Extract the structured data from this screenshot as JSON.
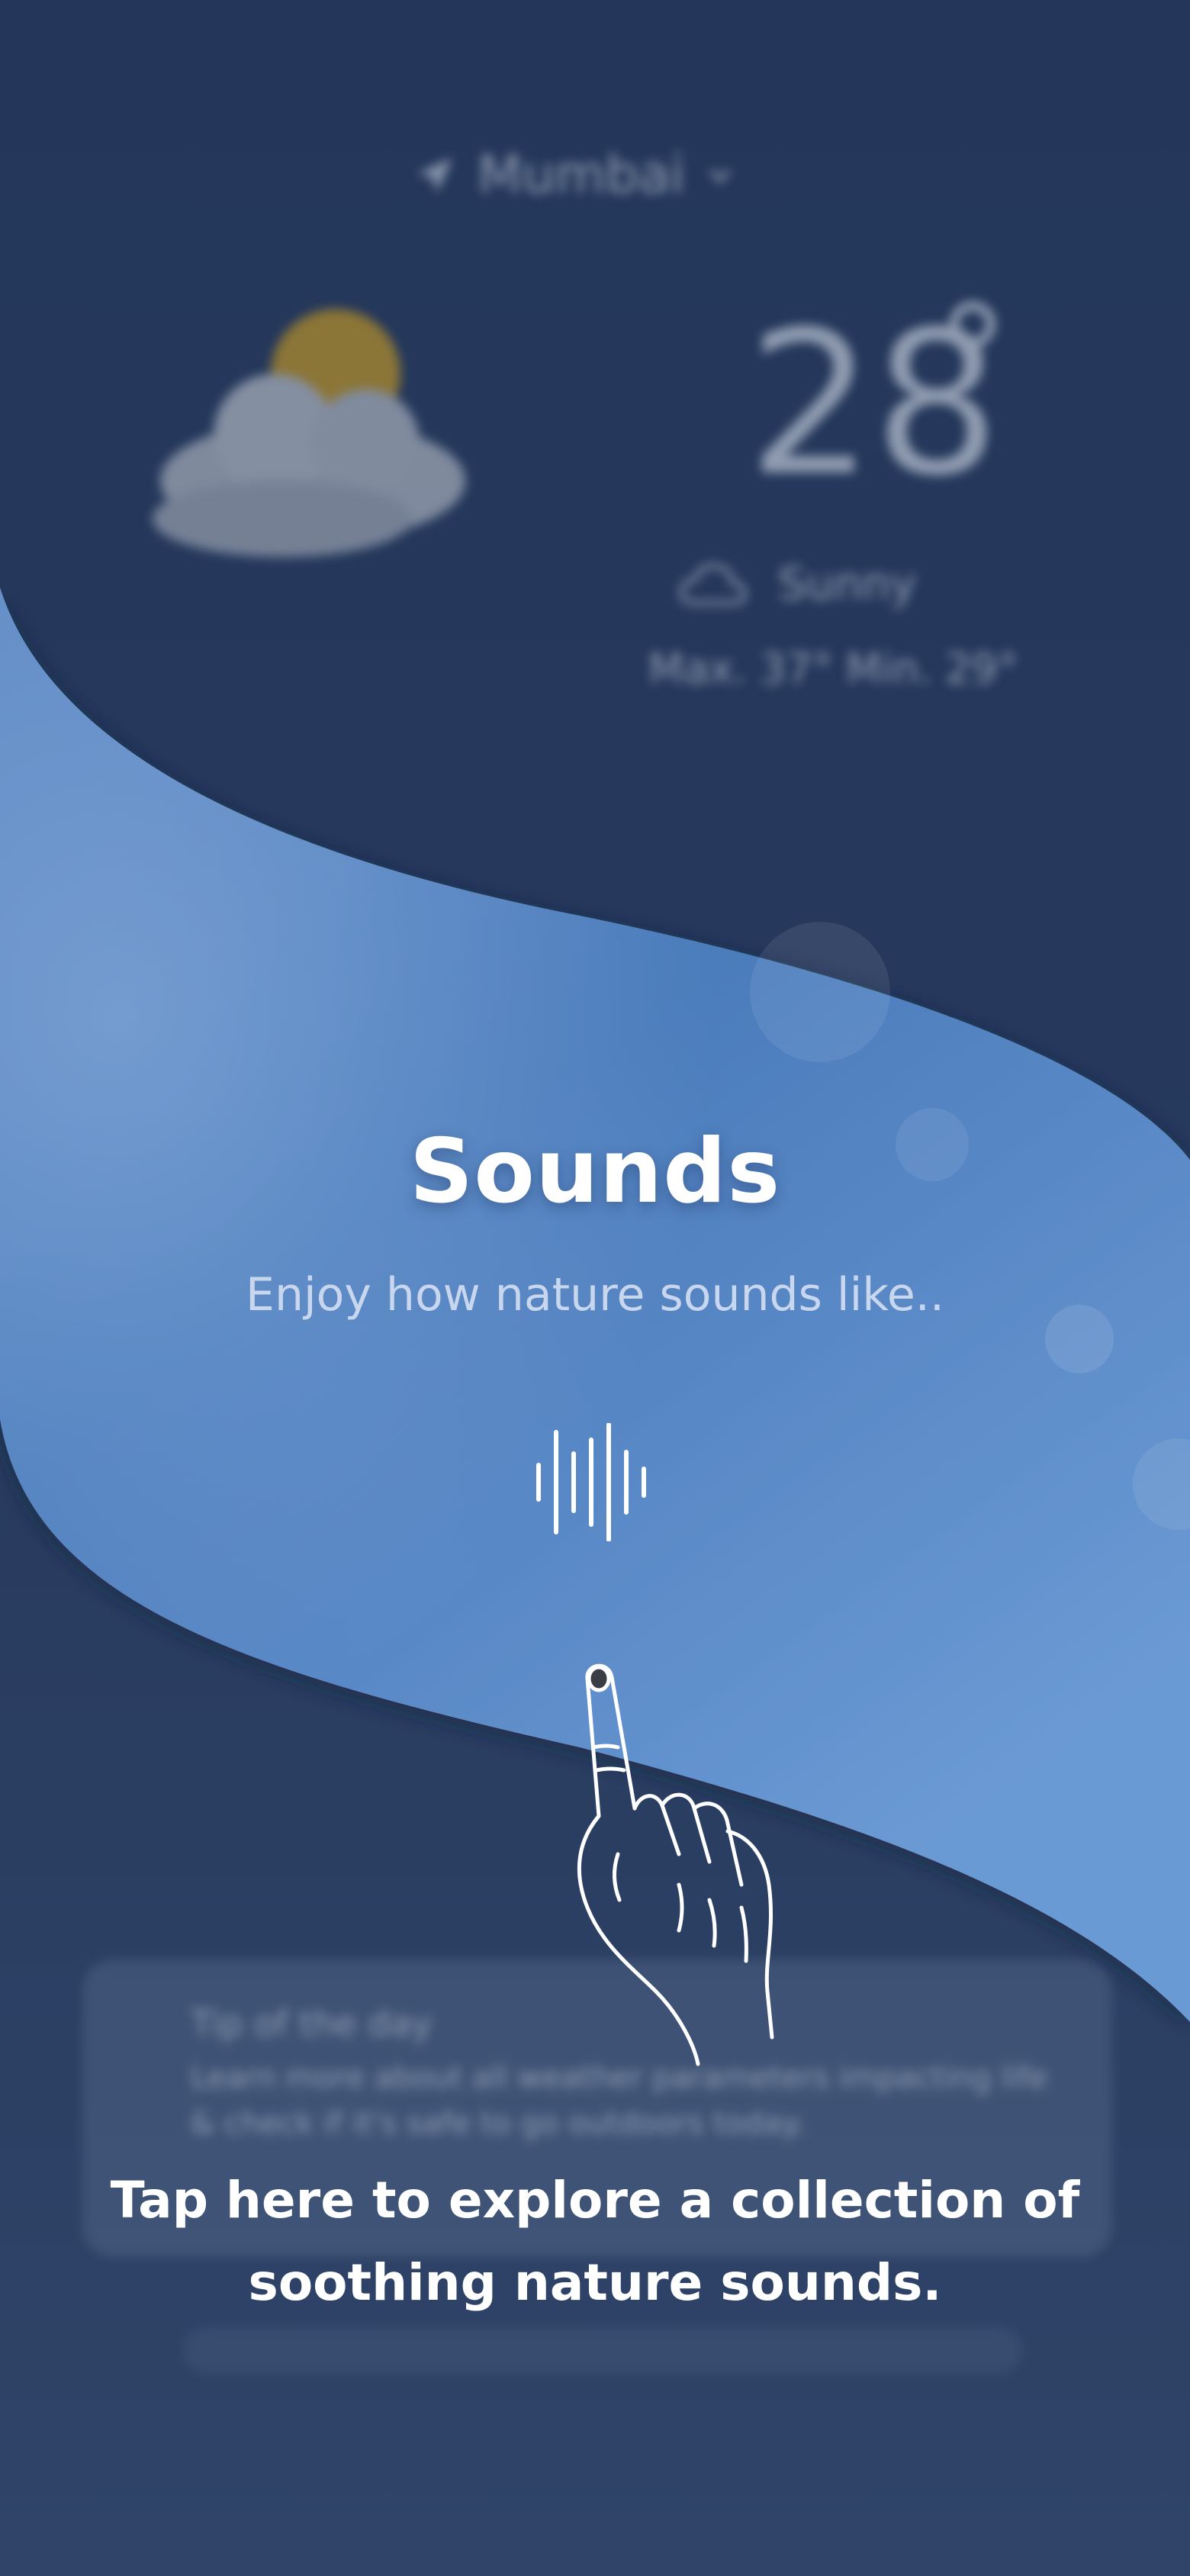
{
  "background": {
    "city": "Mumbai",
    "temperature": "28",
    "condition": "Sunny",
    "min_max": "Max. 37°  Min. 29°",
    "tip_title": "Tip of the day",
    "tip_line1": "Learn more about all weather parameters impacting life",
    "tip_line2": "& check if it's safe to go outdoors today."
  },
  "overlay": {
    "title": "Sounds",
    "subtitle": "Enjoy how nature sounds like..",
    "instruction": "Tap here to explore a collection of soothing nature sounds."
  },
  "icons": {
    "sound": "sound-wave-icon",
    "hand": "tap-hand-icon",
    "weather": "partly-cloudy-icon",
    "location": "location-arrow-icon"
  },
  "colors": {
    "backdrop": "#24375a",
    "wave_light": "#6393cf",
    "wave_dark": "#4a78b3",
    "text": "#ffffff"
  }
}
